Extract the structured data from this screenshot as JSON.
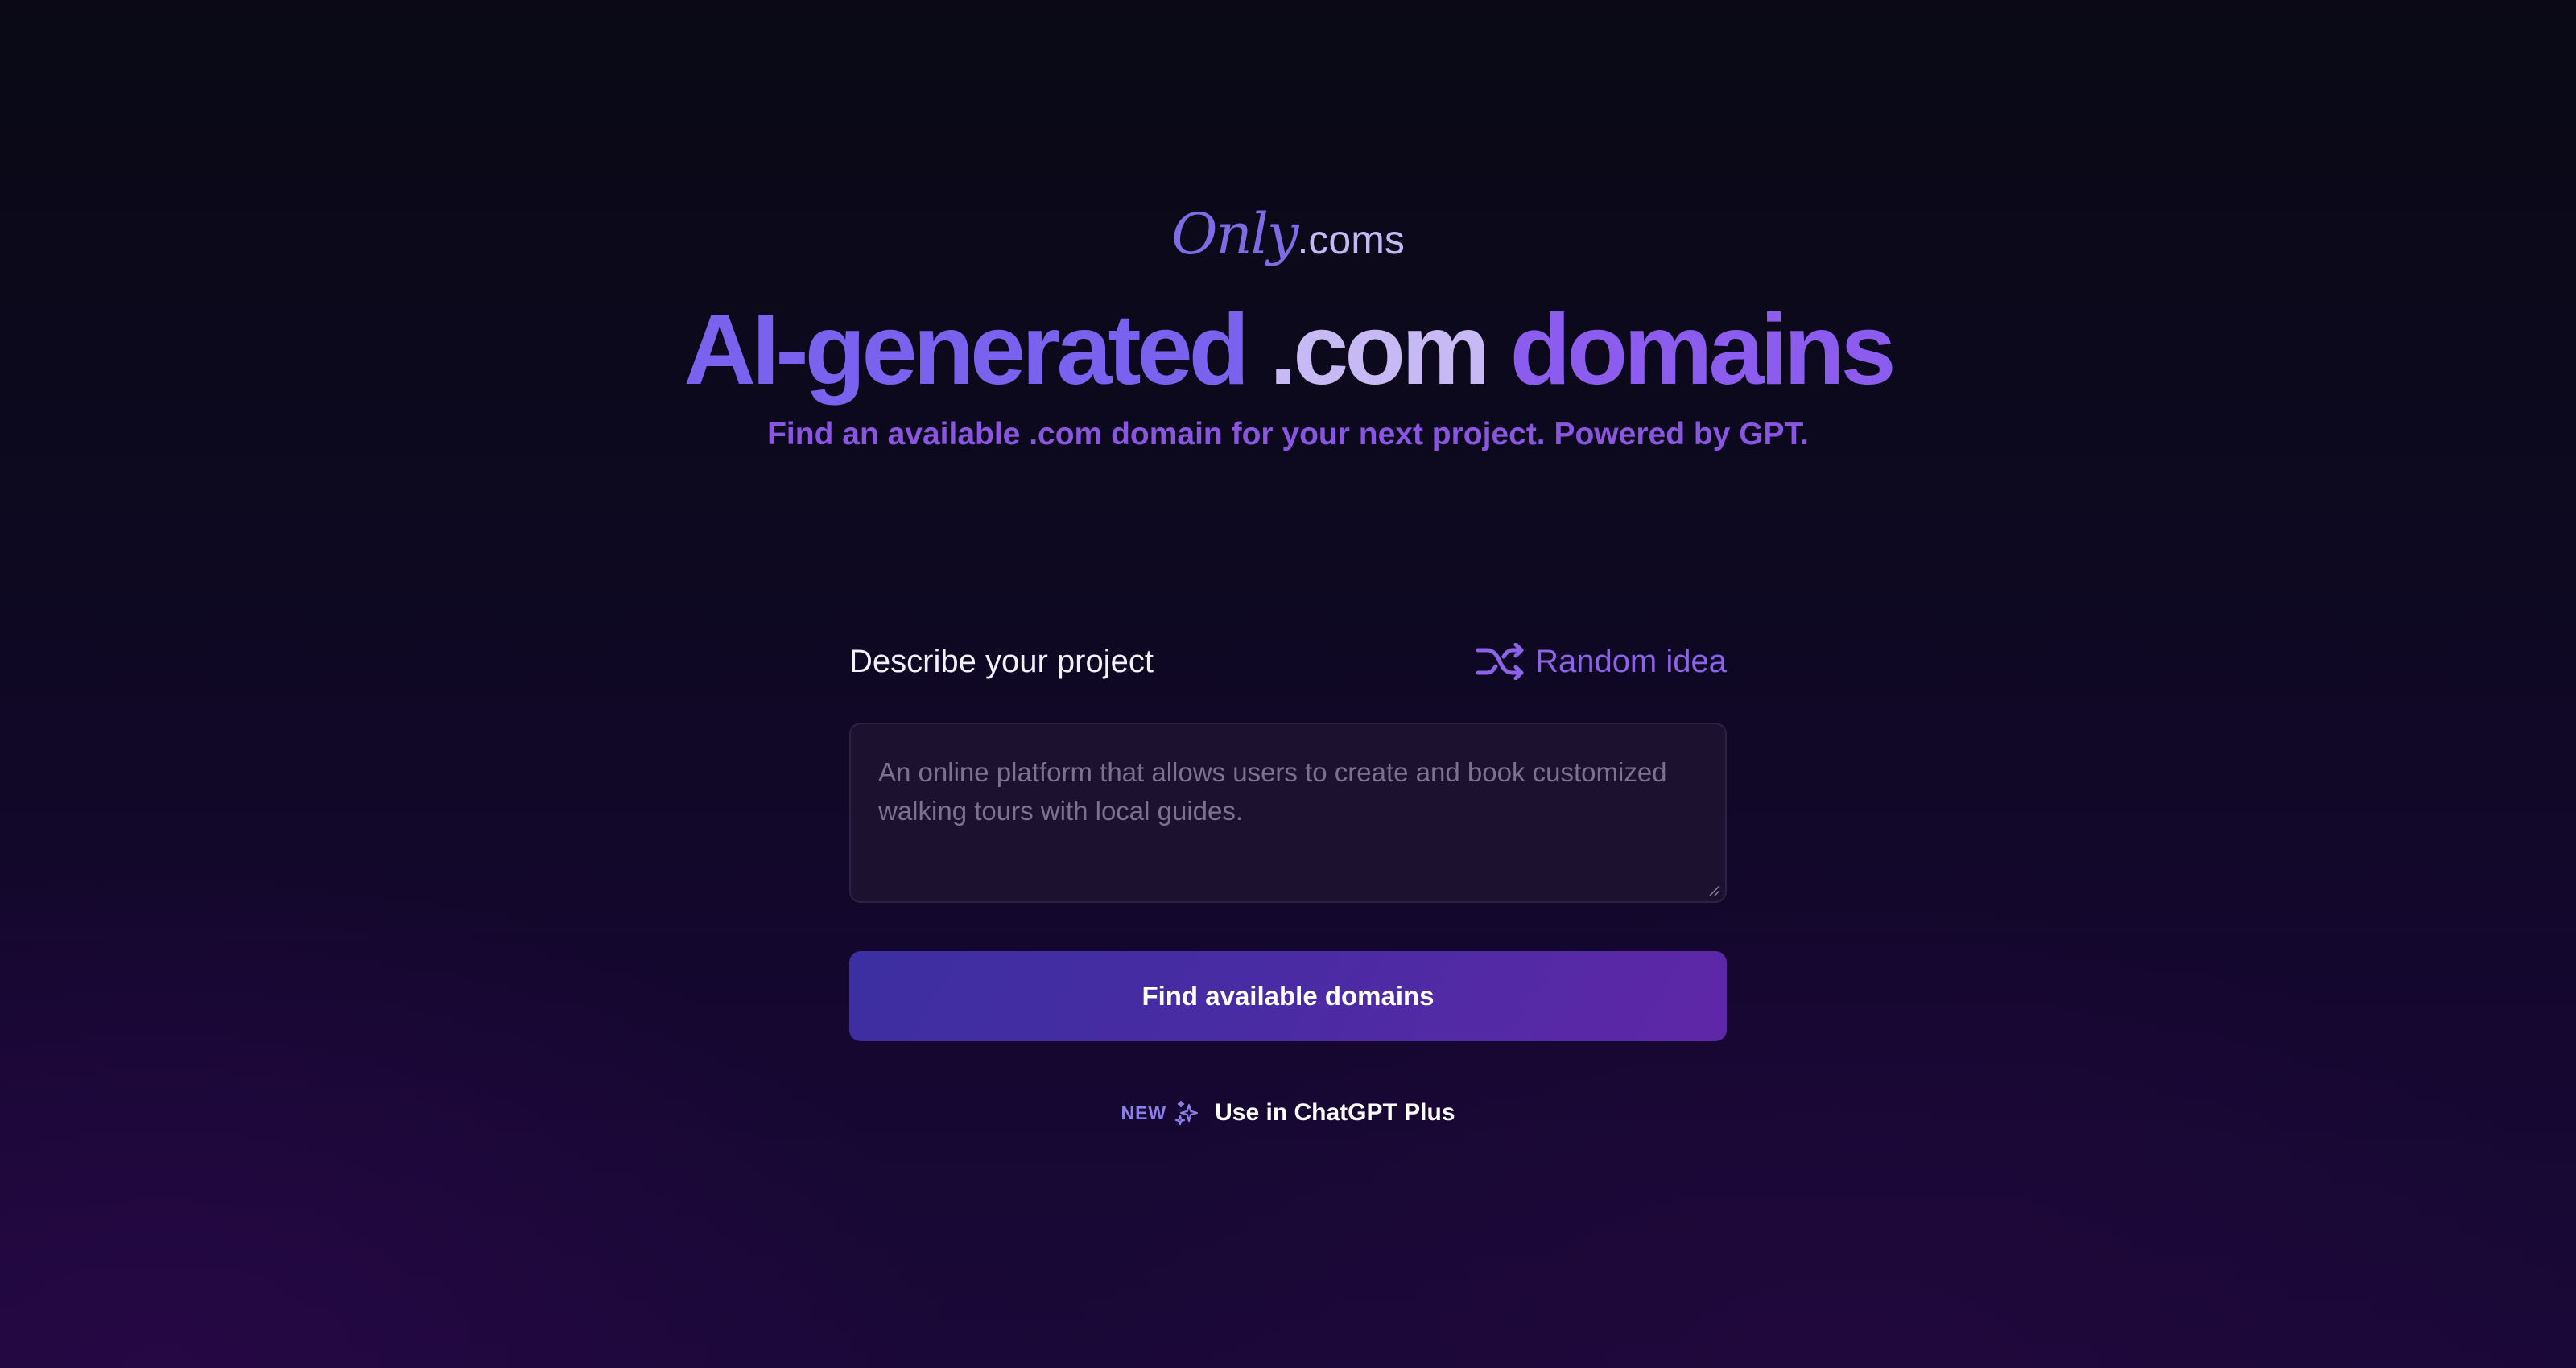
{
  "brand": {
    "logo_script": "Only",
    "logo_suffix": ".coms"
  },
  "hero": {
    "headline_part1": "AI-generated ",
    "headline_part2": ".com",
    "headline_part3": " domains",
    "subheadline": "Find an available .com domain for your next project. Powered by GPT."
  },
  "form": {
    "label": "Describe your project",
    "random_idea_label": "Random idea",
    "random_idea_icon": "shuffle-icon",
    "textarea_value": "",
    "textarea_placeholder": "An online platform that allows users to create and book customized walking tours with local guides.",
    "submit_label": "Find available domains"
  },
  "promo": {
    "badge": "NEW",
    "icon": "sparkles-icon",
    "text": "Use in ChatGPT Plus"
  },
  "colors": {
    "background_top": "#0a0915",
    "background_bottom": "#1a0838",
    "accent_purple": "#7a62ee",
    "accent_violet": "#8c5cee",
    "highlight_lavender": "#c7b9f4",
    "subhead_purple": "#8a55e0",
    "button_start": "#3c2fa1",
    "button_end": "#5f27a8",
    "textarea_bg": "#1c1230"
  }
}
